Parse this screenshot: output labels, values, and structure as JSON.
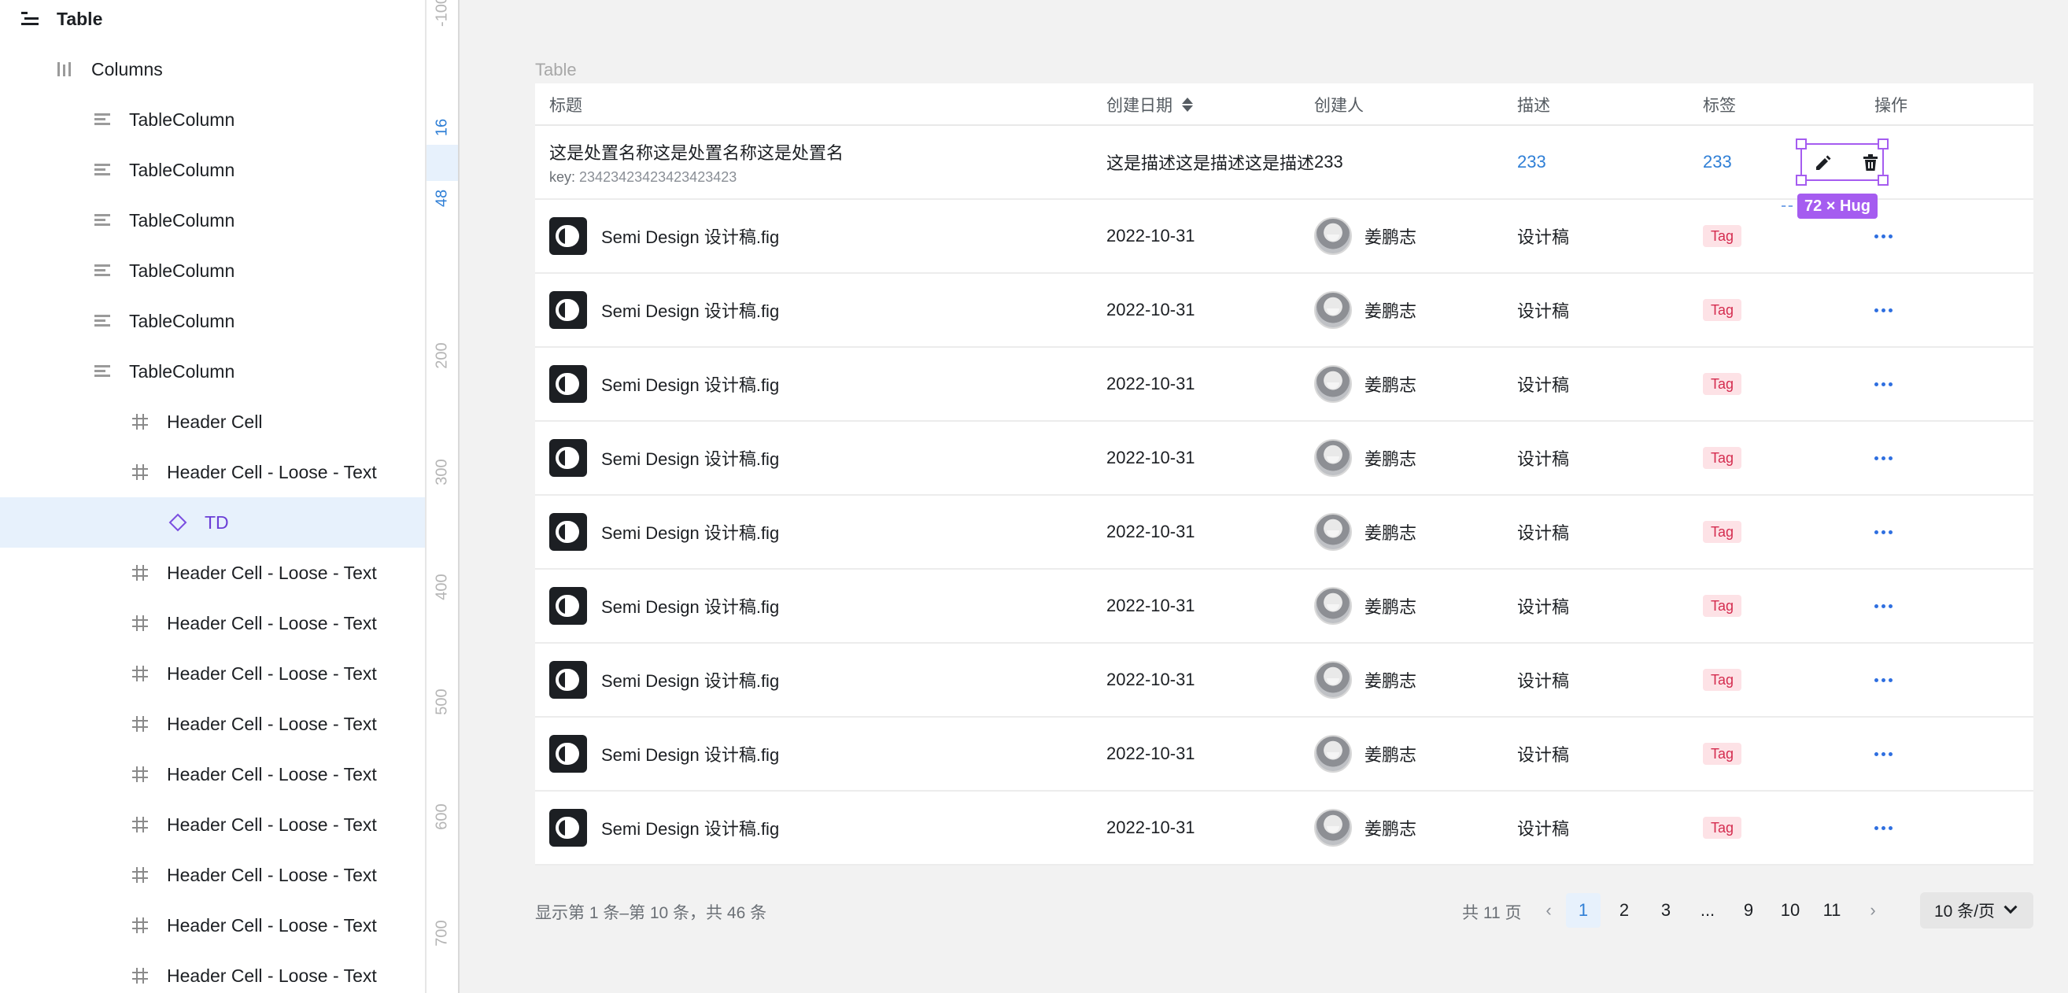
{
  "layers": {
    "root": {
      "label": "Table"
    },
    "items": [
      {
        "label": "Columns",
        "icon": "columns-icon"
      },
      {
        "label": "TableColumn",
        "icon": "lines-icon"
      },
      {
        "label": "TableColumn",
        "icon": "lines-icon"
      },
      {
        "label": "TableColumn",
        "icon": "lines-icon"
      },
      {
        "label": "TableColumn",
        "icon": "lines-icon"
      },
      {
        "label": "TableColumn",
        "icon": "lines-icon"
      },
      {
        "label": "TableColumn",
        "icon": "lines-icon"
      },
      {
        "label": "Header Cell",
        "icon": "frame-hash-icon"
      },
      {
        "label": "Header Cell - Loose - Text",
        "icon": "frame-hash-icon"
      },
      {
        "label": "TD",
        "icon": "component-diamond-icon",
        "selected": true
      },
      {
        "label": "Header Cell - Loose - Text",
        "icon": "frame-hash-icon"
      },
      {
        "label": "Header Cell - Loose - Text",
        "icon": "frame-hash-icon"
      },
      {
        "label": "Header Cell - Loose - Text",
        "icon": "frame-hash-icon"
      },
      {
        "label": "Header Cell - Loose - Text",
        "icon": "frame-hash-icon"
      },
      {
        "label": "Header Cell - Loose - Text",
        "icon": "frame-hash-icon"
      },
      {
        "label": "Header Cell - Loose - Text",
        "icon": "frame-hash-icon"
      },
      {
        "label": "Header Cell - Loose - Text",
        "icon": "frame-hash-icon"
      },
      {
        "label": "Header Cell - Loose - Text",
        "icon": "frame-hash-icon"
      },
      {
        "label": "Header Cell - Loose - Text",
        "icon": "frame-hash-icon"
      }
    ]
  },
  "ruler": {
    "labels": [
      "-100",
      "16",
      "48",
      "200",
      "300",
      "400",
      "500",
      "600",
      "700"
    ],
    "selected_labels": [
      "16",
      "48"
    ]
  },
  "canvas": {
    "frame_label": "Table"
  },
  "table": {
    "columns": [
      "标题",
      "创建日期",
      "创建人",
      "描述",
      "标签",
      "操作"
    ],
    "first_row": {
      "title": "这是处置名称这是处置名称这是处置名",
      "key_label": "key:",
      "key_value": "23423423423423423423",
      "date": "这是描述这是描述这是描述",
      "owner": "233",
      "desc": "233",
      "tag": "233"
    },
    "rows": [
      {
        "name": "Semi Design 设计稿.fig",
        "date": "2022-10-31",
        "owner": "姜鹏志",
        "desc": "设计稿",
        "tag": "Tag"
      },
      {
        "name": "Semi Design 设计稿.fig",
        "date": "2022-10-31",
        "owner": "姜鹏志",
        "desc": "设计稿",
        "tag": "Tag"
      },
      {
        "name": "Semi Design 设计稿.fig",
        "date": "2022-10-31",
        "owner": "姜鹏志",
        "desc": "设计稿",
        "tag": "Tag"
      },
      {
        "name": "Semi Design 设计稿.fig",
        "date": "2022-10-31",
        "owner": "姜鹏志",
        "desc": "设计稿",
        "tag": "Tag"
      },
      {
        "name": "Semi Design 设计稿.fig",
        "date": "2022-10-31",
        "owner": "姜鹏志",
        "desc": "设计稿",
        "tag": "Tag"
      },
      {
        "name": "Semi Design 设计稿.fig",
        "date": "2022-10-31",
        "owner": "姜鹏志",
        "desc": "设计稿",
        "tag": "Tag"
      },
      {
        "name": "Semi Design 设计稿.fig",
        "date": "2022-10-31",
        "owner": "姜鹏志",
        "desc": "设计稿",
        "tag": "Tag"
      },
      {
        "name": "Semi Design 设计稿.fig",
        "date": "2022-10-31",
        "owner": "姜鹏志",
        "desc": "设计稿",
        "tag": "Tag"
      },
      {
        "name": "Semi Design 设计稿.fig",
        "date": "2022-10-31",
        "owner": "姜鹏志",
        "desc": "设计稿",
        "tag": "Tag"
      }
    ]
  },
  "selection": {
    "size_badge": "72 × Hug"
  },
  "pagination": {
    "info": "显示第 1 条–第 10 条，共 46 条",
    "total_pages": "共 11 页",
    "pages": [
      "1",
      "2",
      "3",
      "...",
      "9",
      "10",
      "11"
    ],
    "active_page": "1",
    "page_size": "10 条/页"
  },
  "colors": {
    "accent": "#2f7fd6",
    "selection": "#a55cf0",
    "tag_bg": "#fde2e6",
    "tag_text": "#d42c4f"
  }
}
